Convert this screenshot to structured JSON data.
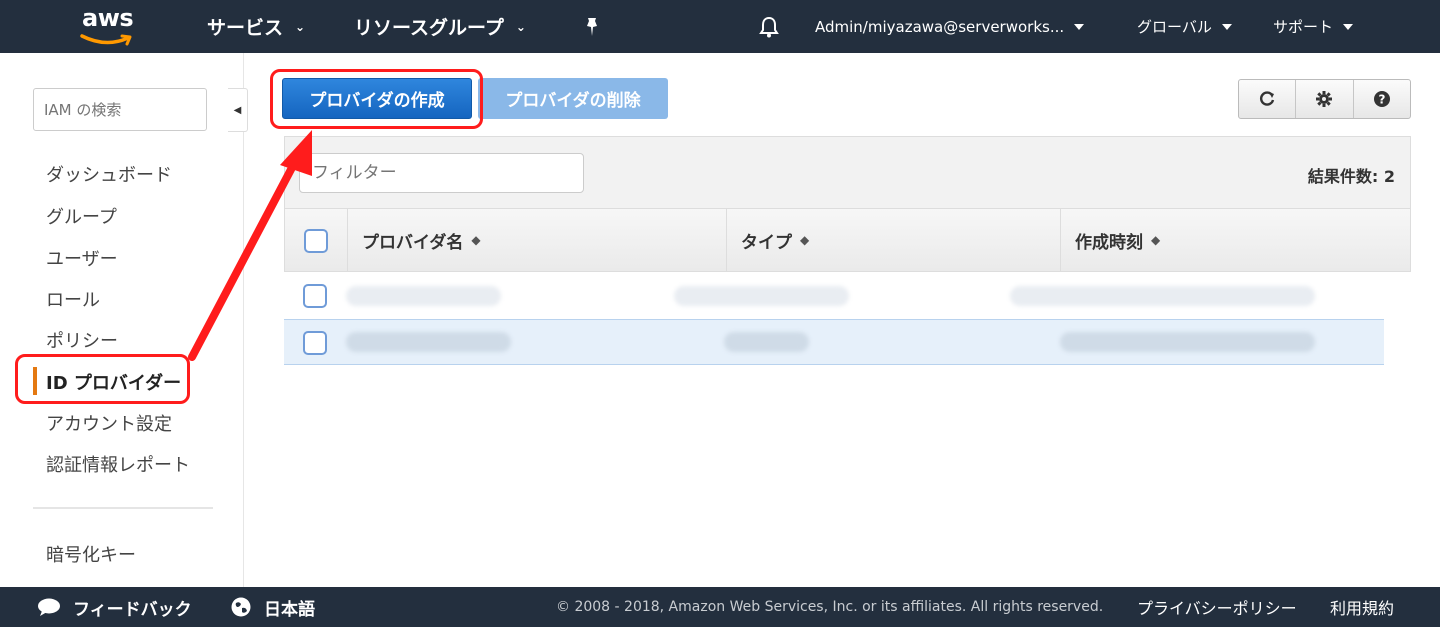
{
  "colors": {
    "nav_bg": "#232f3e",
    "primary_button": "#1e73cc",
    "disabled_button": "#8ab8e8",
    "active_indicator": "#e47911",
    "highlight": "#ff1c1c",
    "selected_row": "#e6f0fa"
  },
  "topnav": {
    "logo_text": "aws",
    "services_label": "サービス",
    "resource_groups_label": "リソースグループ",
    "pin_icon": "pushpin-icon",
    "bell_icon": "bell-icon",
    "account_label": "Admin/miyazawa@serverworks...",
    "region_label": "グローバル",
    "support_label": "サポート"
  },
  "sidebar": {
    "search_placeholder": "IAM の検索",
    "items": [
      {
        "label": "ダッシュボード",
        "active": false
      },
      {
        "label": "グループ",
        "active": false
      },
      {
        "label": "ユーザー",
        "active": false
      },
      {
        "label": "ロール",
        "active": false
      },
      {
        "label": "ポリシー",
        "active": false
      },
      {
        "label": "ID プロバイダー",
        "active": true
      },
      {
        "label": "アカウント設定",
        "active": false
      },
      {
        "label": "認証情報レポート",
        "active": false
      }
    ],
    "encryption_keys_label": "暗号化キー"
  },
  "toolbar": {
    "create_provider_label": "プロバイダの作成",
    "delete_provider_label": "プロバイダの削除",
    "refresh_icon": "refresh-icon",
    "settings_icon": "gear-icon",
    "help_icon": "help-icon"
  },
  "table": {
    "filter_placeholder": "フィルター",
    "result_count": "結果件数: 2",
    "columns": [
      "プロバイダ名",
      "タイプ",
      "作成時刻"
    ],
    "rows": [
      {
        "selected": false,
        "cells": [
          "",
          "",
          ""
        ]
      },
      {
        "selected": true,
        "cells": [
          "",
          "",
          ""
        ]
      }
    ]
  },
  "footer": {
    "feedback_label": "フィードバック",
    "language_label": "日本語",
    "copyright": "© 2008 - 2018, Amazon Web Services, Inc. or its affiliates. All rights reserved.",
    "privacy_label": "プライバシーポリシー",
    "terms_label": "利用規約"
  }
}
